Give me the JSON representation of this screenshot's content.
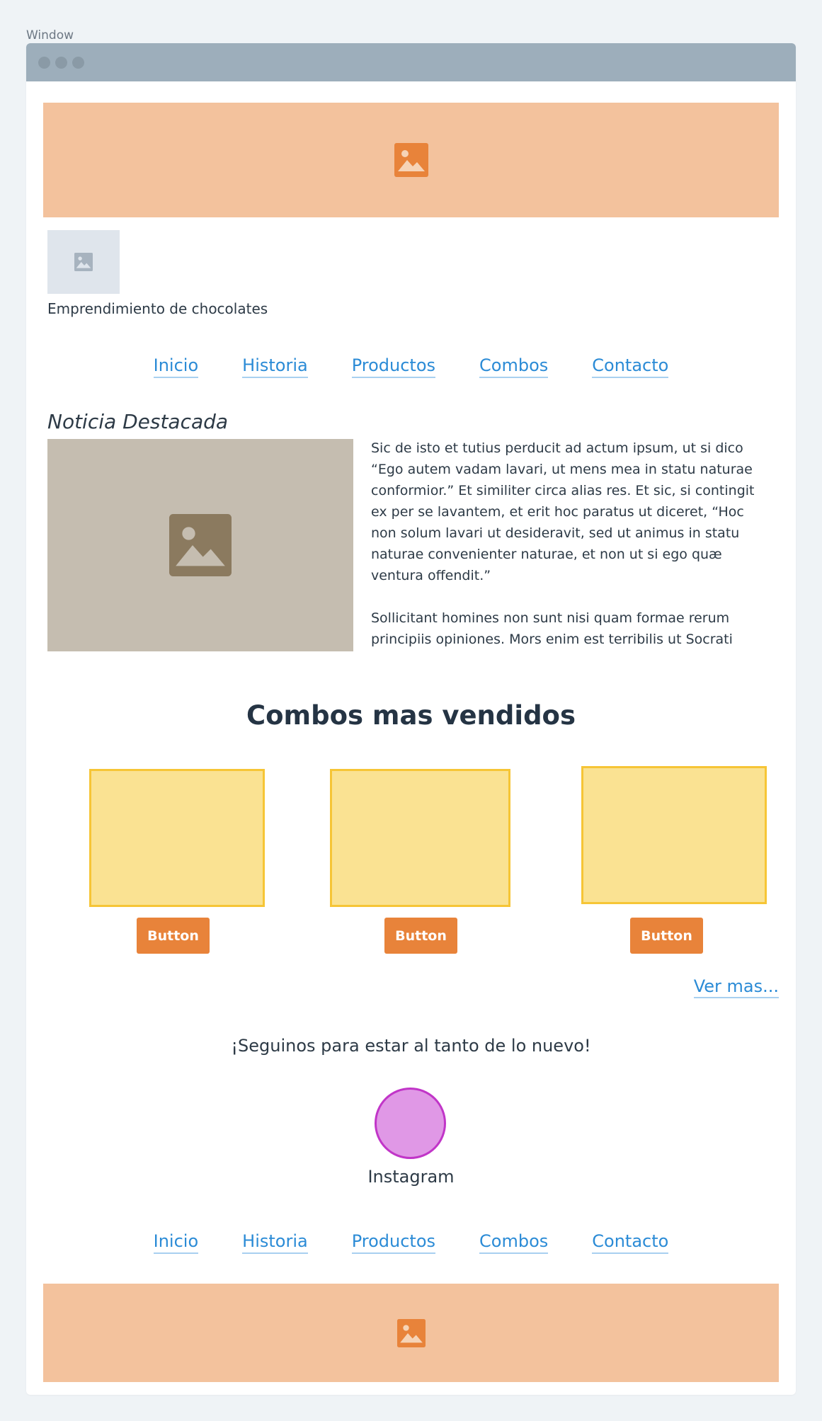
{
  "window": {
    "label": "Window"
  },
  "header": {
    "banner_icon": "image-icon"
  },
  "brand": {
    "logo_icon": "image-icon",
    "name": "Emprendimiento de chocolates"
  },
  "nav_top": [
    {
      "label": "Inicio"
    },
    {
      "label": "Historia"
    },
    {
      "label": "Productos"
    },
    {
      "label": "Combos"
    },
    {
      "label": "Contacto"
    }
  ],
  "featured": {
    "title": "Noticia Destacada",
    "image_icon": "image-icon",
    "paragraphs": [
      "Sic de isto et tutius perducit ad actum ipsum, ut si dico “Ego autem vadam lavari, ut mens mea in statu naturae conformior.” Et similiter circa alias res. Et sic, si contingit ex per se lavantem, et erit hoc paratus ut diceret, “Hoc non solum lavari ut desideravit, sed ut animus in statu naturae convenienter naturae, et non ut si ego quæ ventura offendit.”",
      "Sollicitant homines non sunt nisi quam formae rerum principiis opiniones. Mors enim est terribilis ut Socrati"
    ]
  },
  "combos": {
    "title": "Combos mas vendidos",
    "buttons": [
      {
        "label": "Button"
      },
      {
        "label": "Button"
      },
      {
        "label": "Button"
      }
    ],
    "more_link": "Ver mas..."
  },
  "social": {
    "follow_text": "¡Seguinos para estar al tanto de lo nuevo!",
    "instagram_label": "Instagram"
  },
  "nav_bottom": [
    {
      "label": "Inicio"
    },
    {
      "label": "Historia"
    },
    {
      "label": "Productos"
    },
    {
      "label": "Combos"
    },
    {
      "label": "Contacto"
    }
  ],
  "footer": {
    "banner_icon": "image-icon"
  },
  "colors": {
    "banner": "#f3c29d",
    "accent": "#e8833a",
    "link": "#2b8bd6",
    "card": "#fae292",
    "card_border": "#f6c536",
    "instagram": "#e098e6"
  }
}
